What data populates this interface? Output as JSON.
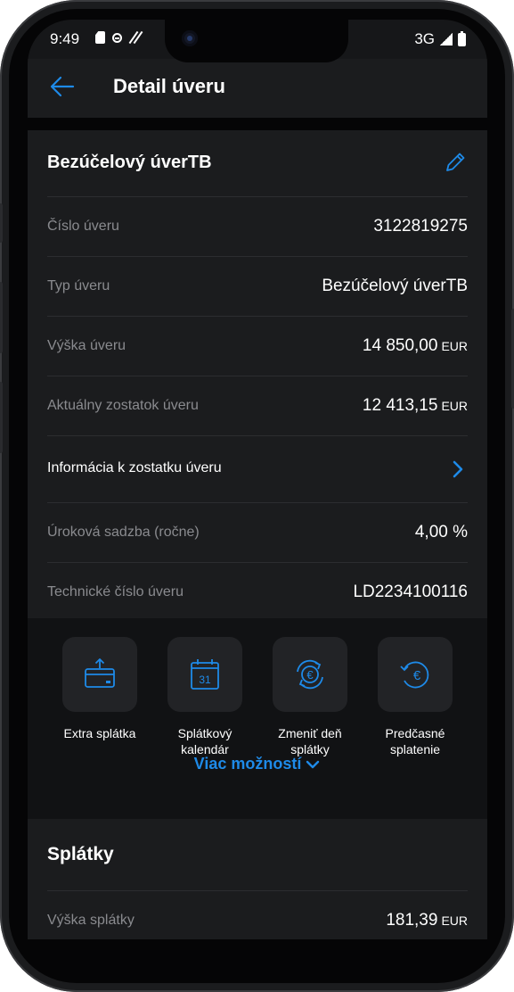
{
  "status_bar": {
    "time": "9:49",
    "network": "3G"
  },
  "header": {
    "title": "Detail úveru"
  },
  "loan": {
    "name": "Bezúčelový úverTB",
    "rows": [
      {
        "label": "Číslo úveru",
        "value": "3122819275",
        "currency": ""
      },
      {
        "label": "Typ úveru",
        "value": "Bezúčelový úverTB",
        "currency": ""
      },
      {
        "label": "Výška úveru",
        "value": "14 850,00",
        "currency": "EUR"
      },
      {
        "label": "Aktuálny zostatok úveru",
        "value": "12 413,15",
        "currency": "EUR"
      }
    ],
    "link_label": "Informácia k zostatku úveru",
    "rows2": [
      {
        "label": "Úroková sadzba (ročne)",
        "value": "4,00 %"
      },
      {
        "label": "Technické číslo úveru",
        "value": "LD2234100116"
      }
    ]
  },
  "actions": {
    "items": [
      {
        "label_line1": "Extra splátka",
        "label_line2": "",
        "icon": "card-upload-icon"
      },
      {
        "label_line1": "Splátkový",
        "label_line2": "kalendár",
        "icon": "calendar-icon",
        "calendar_day": "31"
      },
      {
        "label_line1": "Zmeniť deň",
        "label_line2": "splátky",
        "icon": "euro-cycle-icon"
      },
      {
        "label_line1": "Predčasné",
        "label_line2": "splatenie",
        "icon": "euro-return-icon"
      }
    ],
    "more_label": "Viac možností"
  },
  "installments": {
    "title": "Splátky",
    "row": {
      "label": "Výška splátky",
      "value": "181,39",
      "currency": "EUR"
    }
  },
  "colors": {
    "accent": "#1e8ae8",
    "background": "#161719",
    "card": "#1b1c1e"
  }
}
